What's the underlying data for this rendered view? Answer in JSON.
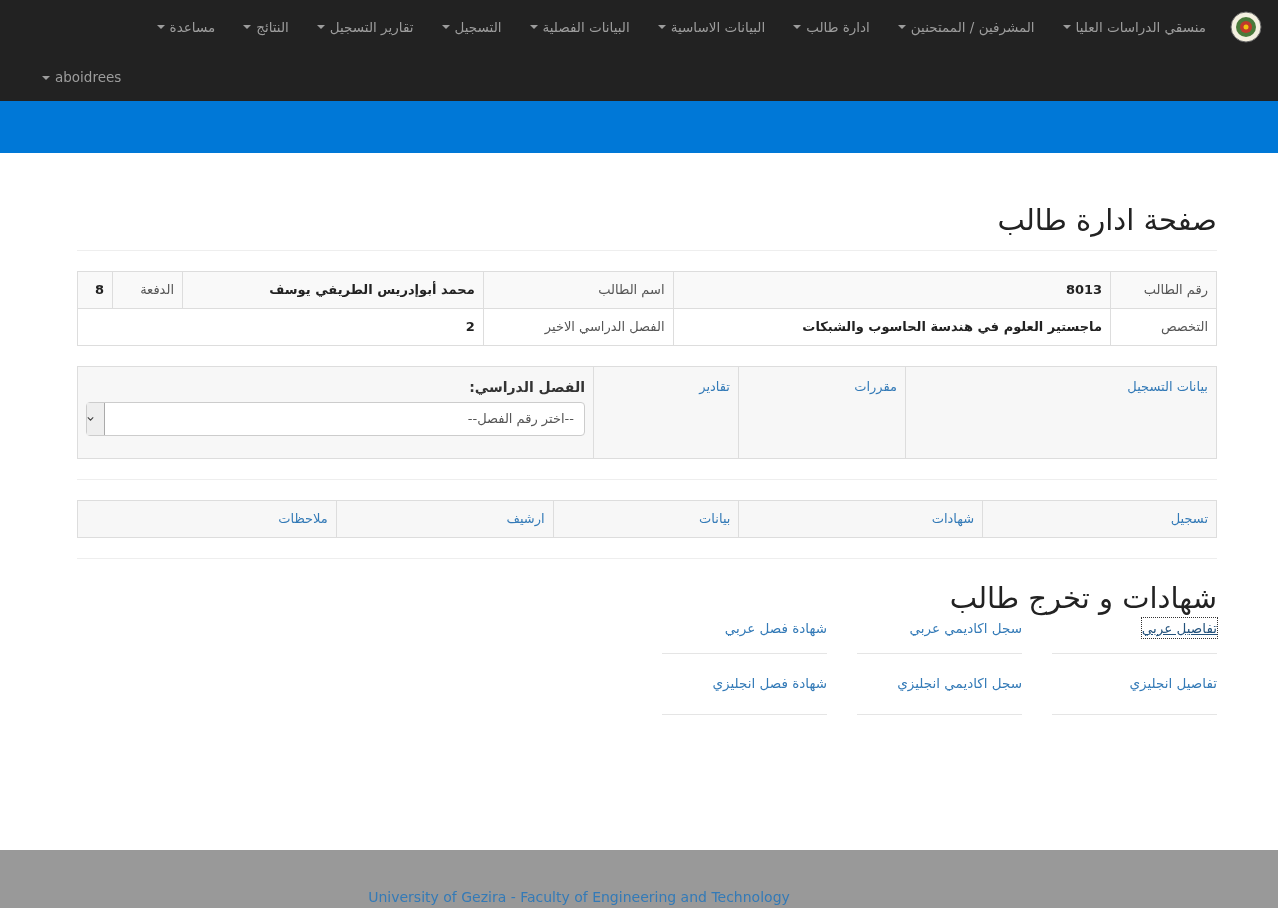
{
  "navbar": {
    "menus": [
      {
        "label": "منسقي الدراسات العليا",
        "has_caret": true
      },
      {
        "label": "المشرفين / الممتحنين",
        "has_caret": true
      },
      {
        "label": "ادارة طالب",
        "has_caret": true
      },
      {
        "label": "البيانات الاساسية",
        "has_caret": true
      },
      {
        "label": "البيانات الفصلية",
        "has_caret": true
      },
      {
        "label": "التسجيل",
        "has_caret": true
      },
      {
        "label": "تقارير التسجيل",
        "has_caret": true
      },
      {
        "label": "النتائج",
        "has_caret": true
      },
      {
        "label": "مساعدة",
        "has_caret": true
      }
    ],
    "user_menu": {
      "label": "aboidrees",
      "has_caret": true
    }
  },
  "page_title": "صفحة ادارة طالب",
  "student_info": {
    "rows": [
      [
        {
          "label": "رقم الطالب",
          "value": "8013"
        },
        {
          "label": "اسم الطالب",
          "value": "محمد أبوإدريس الطريفي يوسف"
        },
        {
          "label": "الدفعة",
          "value": "8"
        }
      ],
      [
        {
          "label": "التخصص",
          "value": "ماجستير العلوم في هندسة الحاسوب والشبكات"
        },
        {
          "label": "الفصل الدراسي الاخير",
          "value": "2"
        }
      ]
    ]
  },
  "links_panel": {
    "links": [
      "بيانات التسجيل",
      "مقررات",
      "تقادير"
    ],
    "semester_label": "الفصل الدراسي:",
    "semester_select": {
      "value": "--اختر رقم الفصل--"
    }
  },
  "tabs": [
    "تسجيل",
    "شهادات",
    "بيانات",
    "ارشيف",
    "ملاحظات"
  ],
  "certificates": {
    "title": "شهادات و تخرج طالب",
    "links": [
      {
        "label": "تفاصيل عربي",
        "focused": true
      },
      {
        "label": "سجل اكاديمي عربي",
        "focused": false
      },
      {
        "label": "شهادة فصل عربي",
        "focused": false
      },
      {
        "label": "تفاصيل انجليزي",
        "focused": false
      },
      {
        "label": "سجل اكاديمي انجليزي",
        "focused": false
      },
      {
        "label": "شهادة فصل انجليزي",
        "focused": false
      }
    ]
  },
  "footer": {
    "text": "University of Gezira - Faculty of Engineering and Technology"
  }
}
